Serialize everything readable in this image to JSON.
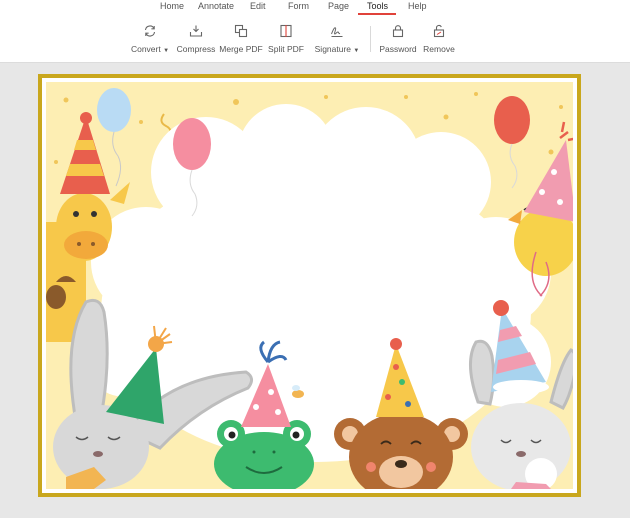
{
  "menu": {
    "tabs": [
      {
        "label": "Home"
      },
      {
        "label": "Annotate"
      },
      {
        "label": "Edit"
      },
      {
        "label": "Form"
      },
      {
        "label": "Page"
      },
      {
        "label": "Tools",
        "active": true
      },
      {
        "label": "Help"
      }
    ]
  },
  "toolbar": {
    "tools": [
      {
        "label": "Convert",
        "icon": "convert-icon",
        "has_dropdown": true
      },
      {
        "label": "Compress",
        "icon": "compress-icon"
      },
      {
        "label": "Merge PDF",
        "icon": "merge-pdf-icon"
      },
      {
        "label": "Split PDF",
        "icon": "split-pdf-icon"
      },
      {
        "label": "Signature",
        "icon": "signature-icon",
        "has_dropdown": true
      },
      {
        "label": "Password",
        "icon": "lock-icon"
      },
      {
        "label": "Remove",
        "icon": "unlock-icon"
      }
    ]
  },
  "colors": {
    "accent": "#e0423a",
    "page_border": "#c9a71d",
    "card_background": "#fdeeb3",
    "workspace": "#e7e7e7"
  },
  "document": {
    "image": "birthday-party-animals-frame"
  }
}
